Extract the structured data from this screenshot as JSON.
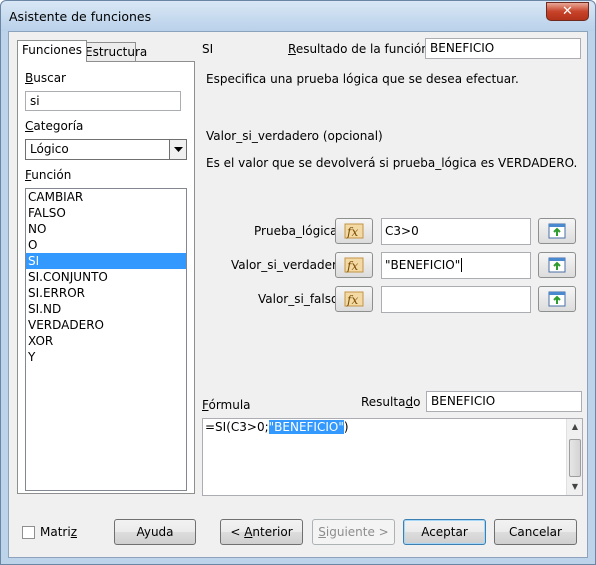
{
  "window": {
    "title": "Asistente de funciones",
    "close_glyph": "✕"
  },
  "tabs": [
    {
      "label": "Funciones",
      "active": true
    },
    {
      "label": "Estructura",
      "active": false
    }
  ],
  "left": {
    "search_label_u": "B",
    "search_label_rest": "uscar",
    "search_value": "si",
    "category_label_u": "C",
    "category_label_rest": "ategoría",
    "category_value": "Lógico",
    "function_label_u": "F",
    "function_label_rest": "unción",
    "functions": [
      "CAMBIAR",
      "FALSO",
      "NO",
      "O",
      "SI",
      "SI.CONJUNTO",
      "SI.ERROR",
      "SI.ND",
      "VERDADERO",
      "XOR",
      "Y"
    ],
    "selected_function": "SI"
  },
  "right": {
    "function_name": "SI",
    "result_label_u": "R",
    "result_label_rest": "esultado de la función",
    "result_value": "BENEFICIO",
    "description": "Especifica una prueba lógica que se desea efectuar.",
    "param_title": "Valor_si_verdadero (opcional)",
    "param_description": "Es el valor que se devolverá si prueba_lógica es VERDADERO.",
    "args": [
      {
        "label": "Prueba_lógica",
        "value": "C3>0"
      },
      {
        "label": "Valor_si_verdadero",
        "value": "\"BENEFICIO\""
      },
      {
        "label": "Valor_si_falso",
        "value": ""
      }
    ],
    "formula_label_u": "F",
    "formula_label_rest": "órmula",
    "result2_label_pre": "Resulta",
    "result2_label_u": "d",
    "result2_label_post": "o",
    "result2_value": "BENEFICIO",
    "formula_prefix": "=SI(C3>0;",
    "formula_selected": "\"BENEFICIO\"",
    "formula_suffix": ")"
  },
  "footer": {
    "matrix_label_pre": "Matri",
    "matrix_label_u": "z",
    "help": "Ayuda",
    "back_pre": "< ",
    "back_u": "A",
    "back_rest": "nterior",
    "next_u": "S",
    "next_rest": "iguiente >",
    "accept": "Aceptar",
    "cancel": "Cancelar"
  },
  "icons": {
    "fx": "fx-icon",
    "select": "shrink-select-icon",
    "dropdown": "chevron-down-icon"
  }
}
